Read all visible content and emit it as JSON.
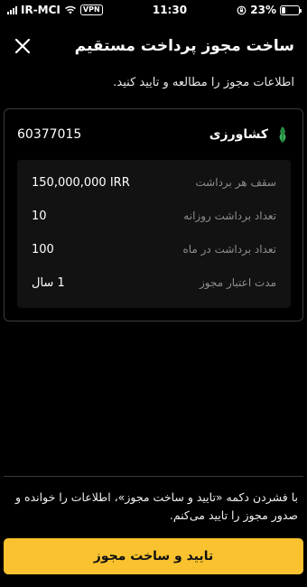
{
  "status_bar": {
    "carrier": "IR-MCI",
    "vpn": "VPN",
    "time": "11:30",
    "battery": "23%",
    "battery_level": 0.23
  },
  "header": {
    "title": "ساخت مجوز پرداخت مستقیم",
    "close_icon": "close-icon"
  },
  "subtitle": "اطلاعات مجوز را مطالعه و تایید کنید.",
  "card": {
    "bank_name": "کشاورزی",
    "bank_icon": "keshavarzi-bank-logo",
    "permit_id": "60377015",
    "details": [
      {
        "label": "سقف هر برداشت",
        "value": "150,000,000 IRR"
      },
      {
        "label": "تعداد برداشت روزانه",
        "value": "10"
      },
      {
        "label": "تعداد برداشت در ماه",
        "value": "100"
      },
      {
        "label": "مدت اعتبار مجوز",
        "value": "1 سال"
      }
    ]
  },
  "consent_text": "با فشردن دکمه «تایید و ساخت مجوز»، اطلاعات را خوانده و صدور مجوز را تایید می‌کنم.",
  "confirm_button": "تایید و ساخت مجوز",
  "colors": {
    "accent": "#f9c22e",
    "background": "#000000",
    "detail_panel": "#121212",
    "label_gray": "#8e8e8e",
    "bank_green": "#2f9e4f"
  }
}
